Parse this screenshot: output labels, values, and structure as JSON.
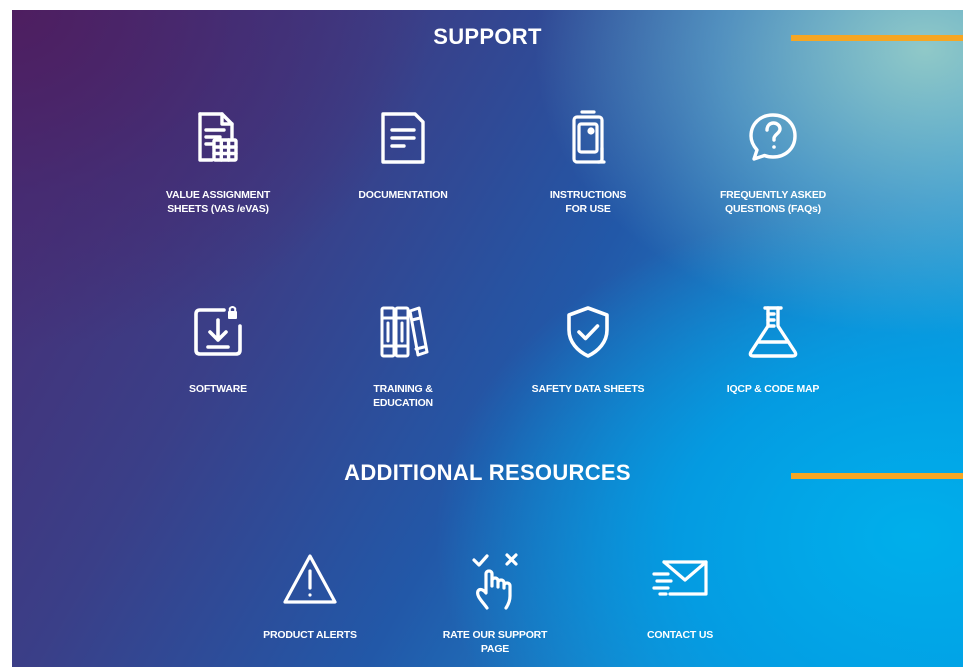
{
  "sections": {
    "support": {
      "title": "SUPPORT",
      "items": [
        {
          "label": "VALUE ASSIGNMENT\nSHEETS (VAS /eVAS)",
          "icon": "spreadsheet-document-icon"
        },
        {
          "label": "DOCUMENTATION",
          "icon": "document-icon"
        },
        {
          "label": "INSTRUCTIONS\nFOR USE",
          "icon": "instructions-clipboard-icon"
        },
        {
          "label": "FREQUENTLY ASKED\nQUESTIONS (FAQs)",
          "icon": "question-bubble-icon"
        },
        {
          "label": "SOFTWARE",
          "icon": "download-locked-icon"
        },
        {
          "label": "TRAINING &\nEDUCATION",
          "icon": "books-icon"
        },
        {
          "label": "SAFETY DATA SHEETS",
          "icon": "shield-check-icon"
        },
        {
          "label": "IQCP & CODE MAP",
          "icon": "flask-icon"
        }
      ]
    },
    "additional": {
      "title": "ADDITIONAL RESOURCES",
      "items": [
        {
          "label": "PRODUCT ALERTS",
          "icon": "warning-triangle-icon"
        },
        {
          "label": "RATE OUR SUPPORT\nPAGE",
          "icon": "tap-rate-icon"
        },
        {
          "label": "CONTACT US",
          "icon": "envelope-icon"
        }
      ]
    }
  },
  "colors": {
    "accent": "#f6a623",
    "text": "#ffffff",
    "gradient_start": "#4b2a70",
    "gradient_end": "#0aa6e2"
  }
}
